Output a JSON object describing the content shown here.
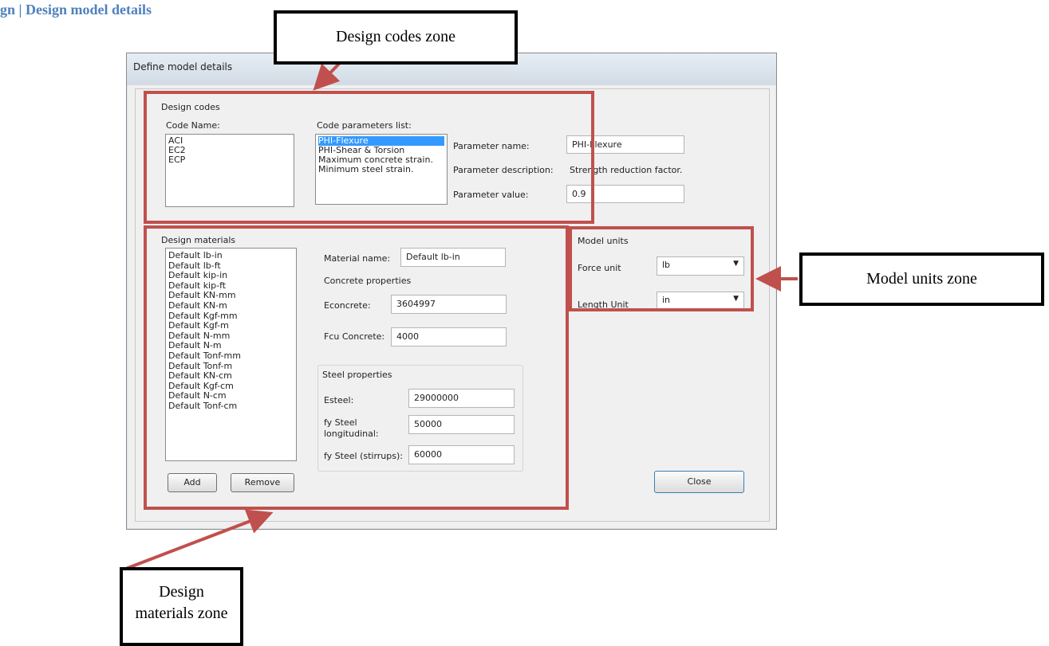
{
  "page_heading": "gn | Design model details",
  "window": {
    "title": "Define model details"
  },
  "design_codes": {
    "group_label": "Design codes",
    "code_name_label": "Code Name:",
    "codes": [
      "ACI",
      "EC2",
      "ECP"
    ],
    "params_label": "Code parameters list:",
    "params": [
      "PHI-Flexure",
      "PHI-Shear & Torsion",
      "Maximum concrete strain.",
      "Minimum steel strain."
    ],
    "selected_param": "PHI-Flexure",
    "param_name_label": "Parameter name:",
    "param_name_value": "PHI-Flexure",
    "param_desc_label": "Parameter description:",
    "param_desc_value": "Strength reduction factor.",
    "param_value_label": "Parameter value:",
    "param_value_value": "0.9"
  },
  "design_materials": {
    "group_label": "Design materials",
    "materials": [
      "Default lb-in",
      "Default lb-ft",
      "Default kip-in",
      "Default kip-ft",
      "Default KN-mm",
      "Default KN-m",
      "Default Kgf-mm",
      "Default Kgf-m",
      "Default N-mm",
      "Default N-m",
      "Default Tonf-mm",
      "Default Tonf-m",
      "Default KN-cm",
      "Default Kgf-cm",
      "Default N-cm",
      "Default Tonf-cm"
    ],
    "material_name_label": "Material name:",
    "material_name_value": "Default lb-in",
    "concrete_props_label": "Concrete properties",
    "econcrete_label": "Econcrete:",
    "econcrete_value": "3604997",
    "fcu_label": "Fcu Concrete:",
    "fcu_value": "4000",
    "steel_props_label": "Steel properties",
    "esteel_label": "Esteel:",
    "esteel_value": "29000000",
    "fy_long_label_1": "fy Steel",
    "fy_long_label_2": "longitudinal:",
    "fy_long_value": "50000",
    "fy_stirrups_label": "fy Steel (stirrups):",
    "fy_stirrups_value": "60000",
    "add_label": "Add",
    "remove_label": "Remove"
  },
  "model_units": {
    "group_label": "Model units",
    "force_label": "Force unit",
    "force_value": "lb",
    "length_label": "Length Unit",
    "length_value": "in"
  },
  "close_label": "Close",
  "callouts": {
    "codes_zone": "Design codes zone",
    "units_zone": "Model units zone",
    "materials_zone": "Design materials zone"
  },
  "colors": {
    "zone_border": "#c0504d",
    "heading": "#4f81bd",
    "selection": "#3399ff"
  }
}
